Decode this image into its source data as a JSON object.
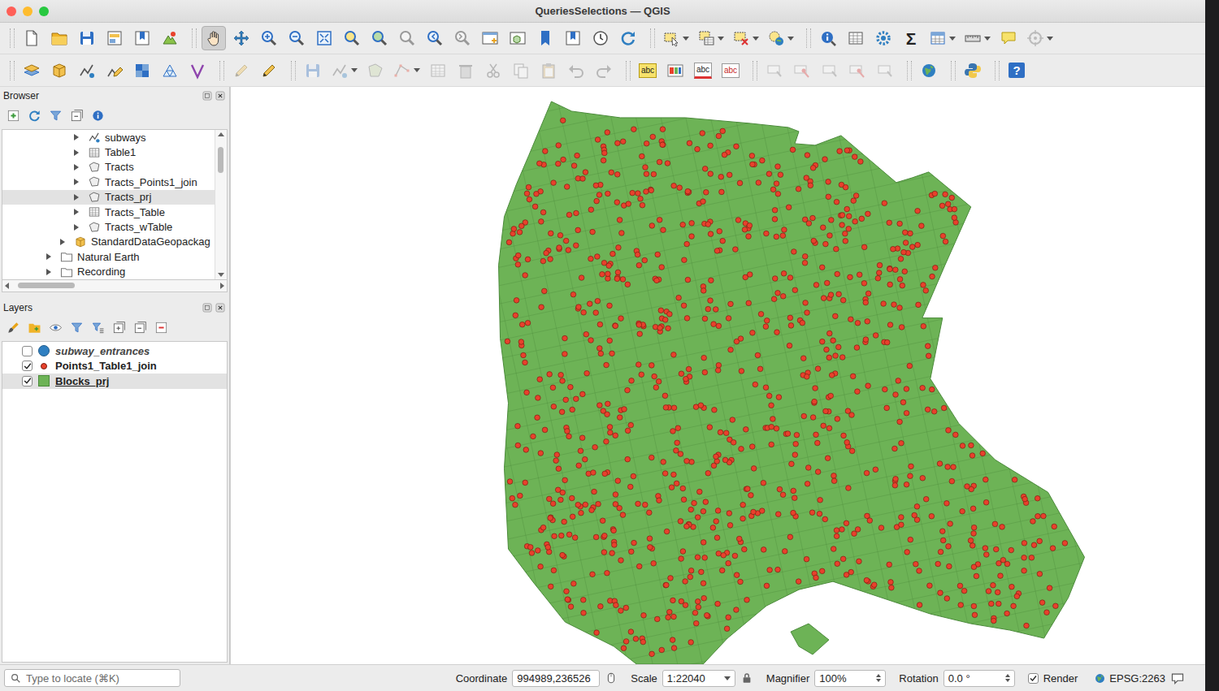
{
  "window": {
    "title": "QueriesSelections — QGIS"
  },
  "toolbar": {
    "glyphs": [
      "Σ",
      "abc",
      "abc",
      "abc",
      "?"
    ],
    "pan_tool_selected": true,
    "editing_enabled": false
  },
  "browser": {
    "title": "Browser",
    "items": [
      {
        "label": "subways",
        "kind": "line",
        "depth": 2,
        "selected": false
      },
      {
        "label": "Table1",
        "kind": "table",
        "depth": 2,
        "selected": false
      },
      {
        "label": "Tracts",
        "kind": "polygon",
        "depth": 2,
        "selected": false
      },
      {
        "label": "Tracts_Points1_join",
        "kind": "polygon",
        "depth": 2,
        "selected": false
      },
      {
        "label": "Tracts_prj",
        "kind": "polygon",
        "depth": 2,
        "selected": true
      },
      {
        "label": "Tracts_Table",
        "kind": "table",
        "depth": 2,
        "selected": false
      },
      {
        "label": "Tracts_wTable",
        "kind": "polygon",
        "depth": 2,
        "selected": false
      },
      {
        "label": "StandardDataGeopackag",
        "kind": "geopackage",
        "depth": 1,
        "selected": false
      },
      {
        "label": "Natural Earth",
        "kind": "folder",
        "depth": 0,
        "selected": false
      },
      {
        "label": "Recording",
        "kind": "folder",
        "depth": 0,
        "selected": false
      }
    ],
    "scroll": {
      "vertical": 0.06,
      "horizontal": 0.03
    }
  },
  "layers": {
    "title": "Layers",
    "items": [
      {
        "name": "subway_entrances",
        "kind": "circle",
        "visible": false,
        "selected": false,
        "color": "#2f7fc1"
      },
      {
        "name": "Points1_Table1_join",
        "kind": "dot",
        "visible": true,
        "selected": false,
        "color": "#e8412c"
      },
      {
        "name": "Blocks_prj",
        "kind": "polygon",
        "visible": true,
        "selected": true,
        "color": "#6db356"
      }
    ]
  },
  "status_bar": {
    "locator_placeholder": "Type to locate (⌘K)",
    "coordinate_label": "Coordinate",
    "coordinate": "994989,236526",
    "scale_label": "Scale",
    "scale": "1:22040",
    "magnifier_label": "Magnifier",
    "magnifier": "100%",
    "rotation_label": "Rotation",
    "rotation": "0.0 °",
    "render_label": "Render",
    "render_checked": true,
    "crs": "EPSG:2263"
  }
}
